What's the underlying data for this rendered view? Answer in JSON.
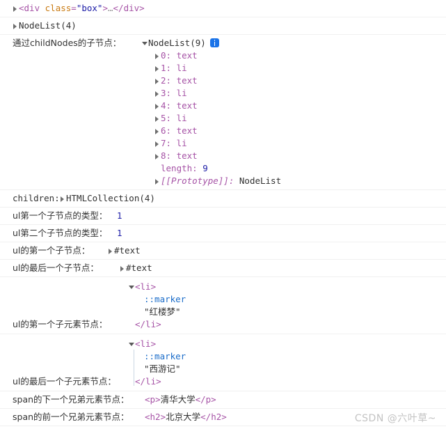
{
  "rows": {
    "div_preview": {
      "tag_open_lt": "<",
      "tag_name": "div",
      "attr_name": "class",
      "attr_eq": "=",
      "attr_value": "\"box\"",
      "tag_open_gt": ">",
      "ellipsis": "…",
      "tag_close": "</div>"
    },
    "nodelist4": {
      "text": "NodeList(4)"
    },
    "childnodes": {
      "label": "通过childNodes的子节点：",
      "header": "NodeList(9)",
      "info_icon": "info-icon",
      "items": [
        {
          "index": "0:",
          "type": "text"
        },
        {
          "index": "1:",
          "type": "li"
        },
        {
          "index": "2:",
          "type": "text"
        },
        {
          "index": "3:",
          "type": "li"
        },
        {
          "index": "4:",
          "type": "text"
        },
        {
          "index": "5:",
          "type": "li"
        },
        {
          "index": "6:",
          "type": "text"
        },
        {
          "index": "7:",
          "type": "li"
        },
        {
          "index": "8:",
          "type": "text"
        }
      ],
      "length_key": "length:",
      "length_value": "9",
      "prototype_key": "[[Prototype]]:",
      "prototype_value": "NodeList"
    },
    "children": {
      "label": "children:",
      "value": "HTMLCollection(4)"
    },
    "first_child_type": {
      "label": "ul第一个子节点的类型：",
      "value": "1"
    },
    "second_child_type": {
      "label": "ul第二个子节点的类型：",
      "value": "1"
    },
    "first_child_node": {
      "label": "ul的第一个子节点：",
      "value": "#text"
    },
    "last_child_node": {
      "label": "ul的最后一个子节点：",
      "value": "#text"
    },
    "first_element_child": {
      "label": "ul的第一个子元素节点：",
      "open_lt": "<",
      "open_name": "li",
      "open_gt": ">",
      "marker": "::marker",
      "string": "\"红楼梦\"",
      "close_tag": "</li>"
    },
    "last_element_child": {
      "label": "ul的最后一个子元素节点：",
      "open_lt": "<",
      "open_name": "li",
      "open_gt": ">",
      "marker": "::marker",
      "string": "\"西游记\"",
      "close_tag": "</li>"
    },
    "next_sibling": {
      "label": "span的下一个兄弟元素节点：",
      "open_lt": "<",
      "open_name": "p",
      "open_gt": ">",
      "content": "清华大学",
      "close_tag": "</p>"
    },
    "prev_sibling": {
      "label": "span的前一个兄弟元素节点：",
      "open_lt": "<",
      "open_name": "h2",
      "open_gt": ">",
      "content": "北京大学",
      "close_tag": "</h2>"
    }
  },
  "watermark": {
    "text": "CSDN @六叶草~"
  },
  "colors": {
    "tag": "#a653a6",
    "attribute": "#c97a12",
    "attribute_value": "#1a1aa6",
    "number": "#1a1aa6",
    "marker": "#1a6cc9",
    "info_badge": "#1a73e8",
    "text": "#303030",
    "separator": "#f0f0f0"
  }
}
